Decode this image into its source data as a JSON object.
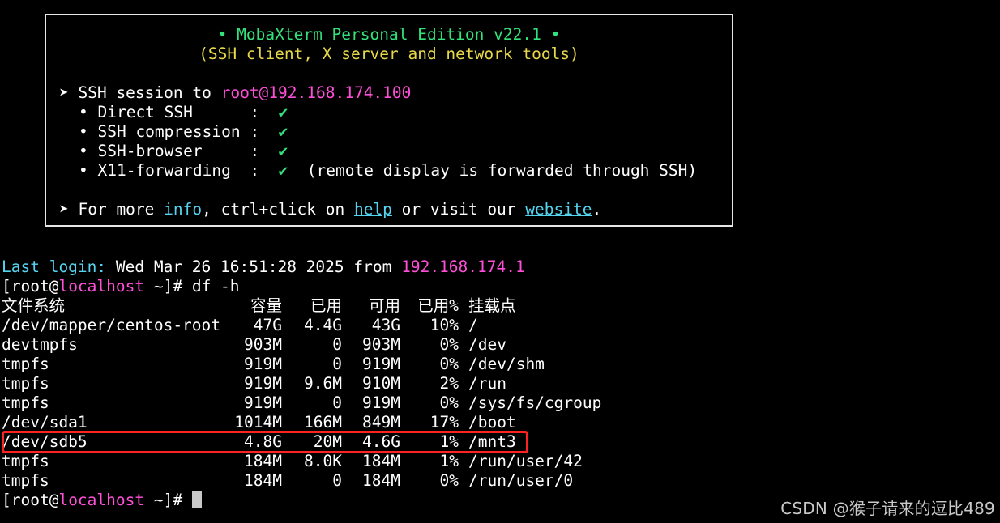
{
  "colors": {
    "background": "#000000",
    "green": "#34e27c",
    "yellow": "#e7d84a",
    "magenta": "#ff4fd8",
    "cyan": "#55d4f0",
    "highlight_box": "#ff2222"
  },
  "banner": {
    "title": "• MobaXterm Personal Edition v22.1 •",
    "subtitle": "(SSH client, X server and network tools)",
    "session_prefix": "➤ SSH session to ",
    "session_host": "root@192.168.174.100",
    "features": [
      {
        "label": "• Direct SSH      :",
        "check": "✔",
        "note": ""
      },
      {
        "label": "• SSH compression :",
        "check": "✔",
        "note": ""
      },
      {
        "label": "• SSH-browser     :",
        "check": "✔",
        "note": ""
      },
      {
        "label": "• X11-forwarding  :",
        "check": "✔",
        "note": "(remote display is forwarded through SSH)"
      }
    ],
    "more_prefix": "➤ For more ",
    "more_info": "info",
    "more_mid": ", ctrl+click on ",
    "more_help": "help",
    "more_mid2": " or visit our ",
    "more_website": "website",
    "more_end": "."
  },
  "terminal": {
    "last_login_label": "Last login:",
    "last_login_text": " Wed Mar 26 16:51:28 2025 from ",
    "last_login_ip": "192.168.174.1",
    "prompt_open": "[root@",
    "prompt_host": "localhost",
    "prompt_close": " ~]#",
    "command": " df -h",
    "df_headers": [
      "文件系统",
      "容量",
      "已用",
      "可用",
      "已用%",
      "挂载点"
    ],
    "df_rows": [
      [
        "/dev/mapper/centos-root",
        "47G",
        "4.4G",
        "43G",
        "10%",
        "/"
      ],
      [
        "devtmpfs",
        "903M",
        "0",
        "903M",
        "0%",
        "/dev"
      ],
      [
        "tmpfs",
        "919M",
        "0",
        "919M",
        "0%",
        "/dev/shm"
      ],
      [
        "tmpfs",
        "919M",
        "9.6M",
        "910M",
        "2%",
        "/run"
      ],
      [
        "tmpfs",
        "919M",
        "0",
        "919M",
        "0%",
        "/sys/fs/cgroup"
      ],
      [
        "/dev/sda1",
        "1014M",
        "166M",
        "849M",
        "17%",
        "/boot"
      ],
      [
        "/dev/sdb5",
        "4.8G",
        "20M",
        "4.6G",
        "1%",
        "/mnt3"
      ],
      [
        "tmpfs",
        "184M",
        "8.0K",
        "184M",
        "1%",
        "/run/user/42"
      ],
      [
        "tmpfs",
        "184M",
        "0",
        "184M",
        "0%",
        "/run/user/0"
      ]
    ]
  },
  "watermark": "CSDN @猴子请来的逗比489"
}
